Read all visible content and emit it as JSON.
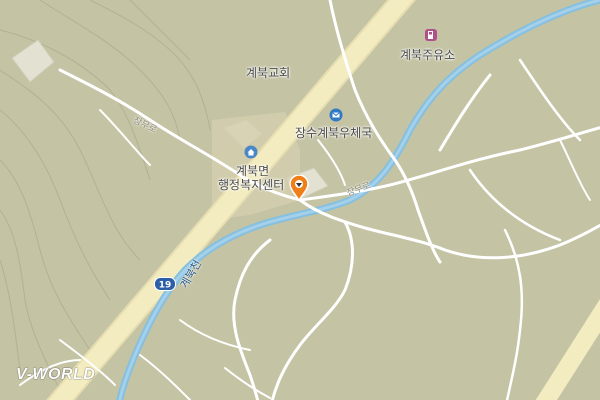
{
  "map": {
    "labels": {
      "church": "계북교회",
      "post_office": "장수계북우체국",
      "gas_station": "계북주유소",
      "township_office_line1": "계북면",
      "township_office_line2": "행정복지센터"
    },
    "road_labels": {
      "jangmu_ro_west": "장무로",
      "jangmu_ro_east": "장무로"
    },
    "stream_label": "계북천",
    "route_shield": "19",
    "logo": "V-WORLD",
    "colors": {
      "terrain": "#c4c3a4",
      "road_minor": "#ffffff",
      "highway": "#f3ecc0",
      "stream": "#86c0e0",
      "marker": "#f07f1a"
    },
    "icons": {
      "church": "building-icon",
      "post_office": "mail-icon",
      "gas_station": "fuel-icon",
      "township_office": "home-icon",
      "marker": "location-marker-icon"
    }
  }
}
